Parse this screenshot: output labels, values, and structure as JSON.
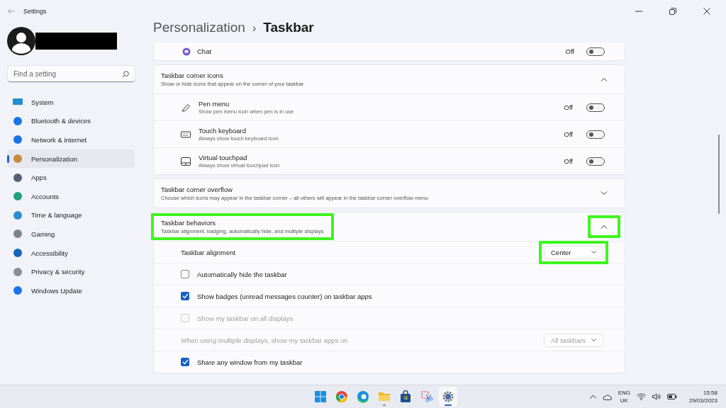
{
  "window": {
    "title": "Settings"
  },
  "search": {
    "placeholder": "Find a setting"
  },
  "sidebar": {
    "items": [
      {
        "label": "System",
        "selected": false
      },
      {
        "label": "Bluetooth & devices",
        "selected": false
      },
      {
        "label": "Network & internet",
        "selected": false
      },
      {
        "label": "Personalization",
        "selected": true
      },
      {
        "label": "Apps",
        "selected": false
      },
      {
        "label": "Accounts",
        "selected": false
      },
      {
        "label": "Time & language",
        "selected": false
      },
      {
        "label": "Gaming",
        "selected": false
      },
      {
        "label": "Accessibility",
        "selected": false
      },
      {
        "label": "Privacy & security",
        "selected": false
      },
      {
        "label": "Windows Update",
        "selected": false
      }
    ]
  },
  "breadcrumb": {
    "parent": "Personalization",
    "separator": "›",
    "current": "Taskbar"
  },
  "chat": {
    "label": "Chat",
    "state": "Off",
    "on": false
  },
  "sections": [
    {
      "title": "Taskbar corner icons",
      "subtitle": "Show or hide icons that appear on the corner of your taskbar",
      "expanded": true,
      "highlighted": false,
      "chevron_highlighted": false,
      "items": [
        {
          "kind": "toggle",
          "label": "Pen menu",
          "description": "Show pen menu icon when pen is in use",
          "state": "Off",
          "on": false
        },
        {
          "kind": "toggle",
          "label": "Touch keyboard",
          "description": "Always show touch keyboard icon",
          "state": "Off",
          "on": false
        },
        {
          "kind": "toggle",
          "label": "Virtual touchpad",
          "description": "Always show virtual touchpad icon",
          "state": "Off",
          "on": false
        }
      ]
    },
    {
      "title": "Taskbar corner overflow",
      "subtitle": "Choose which icons may appear in the taskbar corner – all others will appear in the taskbar corner overflow menu",
      "expanded": false,
      "highlighted": false,
      "chevron_highlighted": false
    },
    {
      "title": "Taskbar behaviors",
      "subtitle": "Taskbar alignment, badging, automatically hide, and multiple displays",
      "expanded": true,
      "highlighted": true,
      "chevron_highlighted": true,
      "items": [
        {
          "kind": "dropdown",
          "label": "Taskbar alignment",
          "value": "Center",
          "disabled": false,
          "highlighted": true
        },
        {
          "kind": "checkbox",
          "label": "Automatically hide the taskbar",
          "checked": false,
          "disabled": false
        },
        {
          "kind": "checkbox",
          "label": "Show badges (unread messages counter) on taskbar apps",
          "checked": true,
          "disabled": false
        },
        {
          "kind": "checkbox",
          "label": "Show my taskbar on all displays",
          "checked": false,
          "disabled": true
        },
        {
          "kind": "dropdown",
          "label": "When using multiple displays, show my taskbar apps on",
          "value": "All taskbars",
          "disabled": true,
          "highlighted": false
        },
        {
          "kind": "checkbox",
          "label": "Share any window from my taskbar",
          "checked": true,
          "disabled": false
        }
      ]
    }
  ],
  "taskbar": {
    "apps": [
      {
        "selected": false,
        "running": false
      },
      {
        "selected": false,
        "running": false
      },
      {
        "selected": false,
        "running": false
      },
      {
        "selected": false,
        "running": true
      },
      {
        "selected": false,
        "running": false
      },
      {
        "selected": false,
        "running": false
      },
      {
        "selected": true,
        "running": true
      }
    ],
    "language": "ENG",
    "region": "UK",
    "time": "15:58",
    "date": "29/03/2023"
  }
}
